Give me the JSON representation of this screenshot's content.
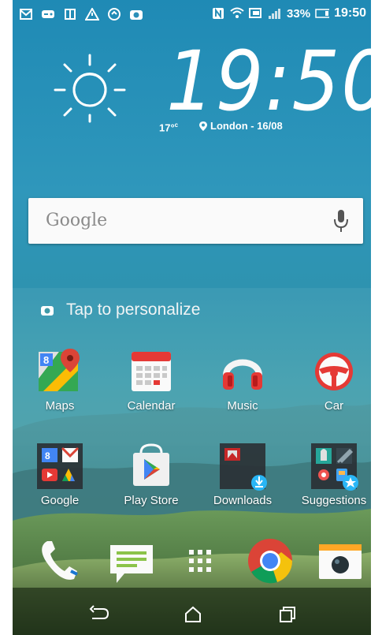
{
  "status_bar": {
    "left_icons": [
      "gmail-icon",
      "gamepad-icon",
      "book-icon",
      "warning-icon",
      "sync-icon",
      "camera-icon"
    ],
    "right_icons": [
      "nfc-icon",
      "wifi-icon",
      "cast-icon",
      "signal-icon"
    ],
    "battery_percent": "33%",
    "time": "19:50"
  },
  "weather": {
    "icon": "sun-icon",
    "clock": "19:50",
    "temperature": "17°",
    "temperature_unit": "c",
    "location": "London - 16/08"
  },
  "search": {
    "placeholder": "Google",
    "mic_icon": "mic-icon"
  },
  "personalize": {
    "label": "Tap to personalize",
    "icon": "camera-icon"
  },
  "apps_row1": [
    {
      "label": "Maps",
      "icon": "maps-icon"
    },
    {
      "label": "Calendar",
      "icon": "calendar-icon"
    },
    {
      "label": "Music",
      "icon": "headphones-icon"
    },
    {
      "label": "Car",
      "icon": "steering-wheel-icon"
    }
  ],
  "apps_row2": [
    {
      "label": "Google",
      "icon": "google-folder-icon"
    },
    {
      "label": "Play Store",
      "icon": "play-store-icon"
    },
    {
      "label": "Downloads",
      "icon": "downloads-folder-icon"
    },
    {
      "label": "Suggestions",
      "icon": "suggestions-folder-icon"
    }
  ],
  "dock": [
    {
      "icon": "phone-icon"
    },
    {
      "icon": "messages-icon"
    },
    {
      "icon": "app-drawer-icon"
    },
    {
      "icon": "chrome-icon"
    },
    {
      "icon": "camera-app-icon"
    }
  ],
  "navigation": {
    "back": "back-icon",
    "home": "home-icon",
    "recents": "recents-icon"
  },
  "colors": {
    "sky": "#2f97bb",
    "search_bg": "#fafafa",
    "chrome_red": "#db4437",
    "chrome_yellow": "#f4c20d",
    "chrome_green": "#0f9d58",
    "chrome_blue": "#4285f4"
  }
}
